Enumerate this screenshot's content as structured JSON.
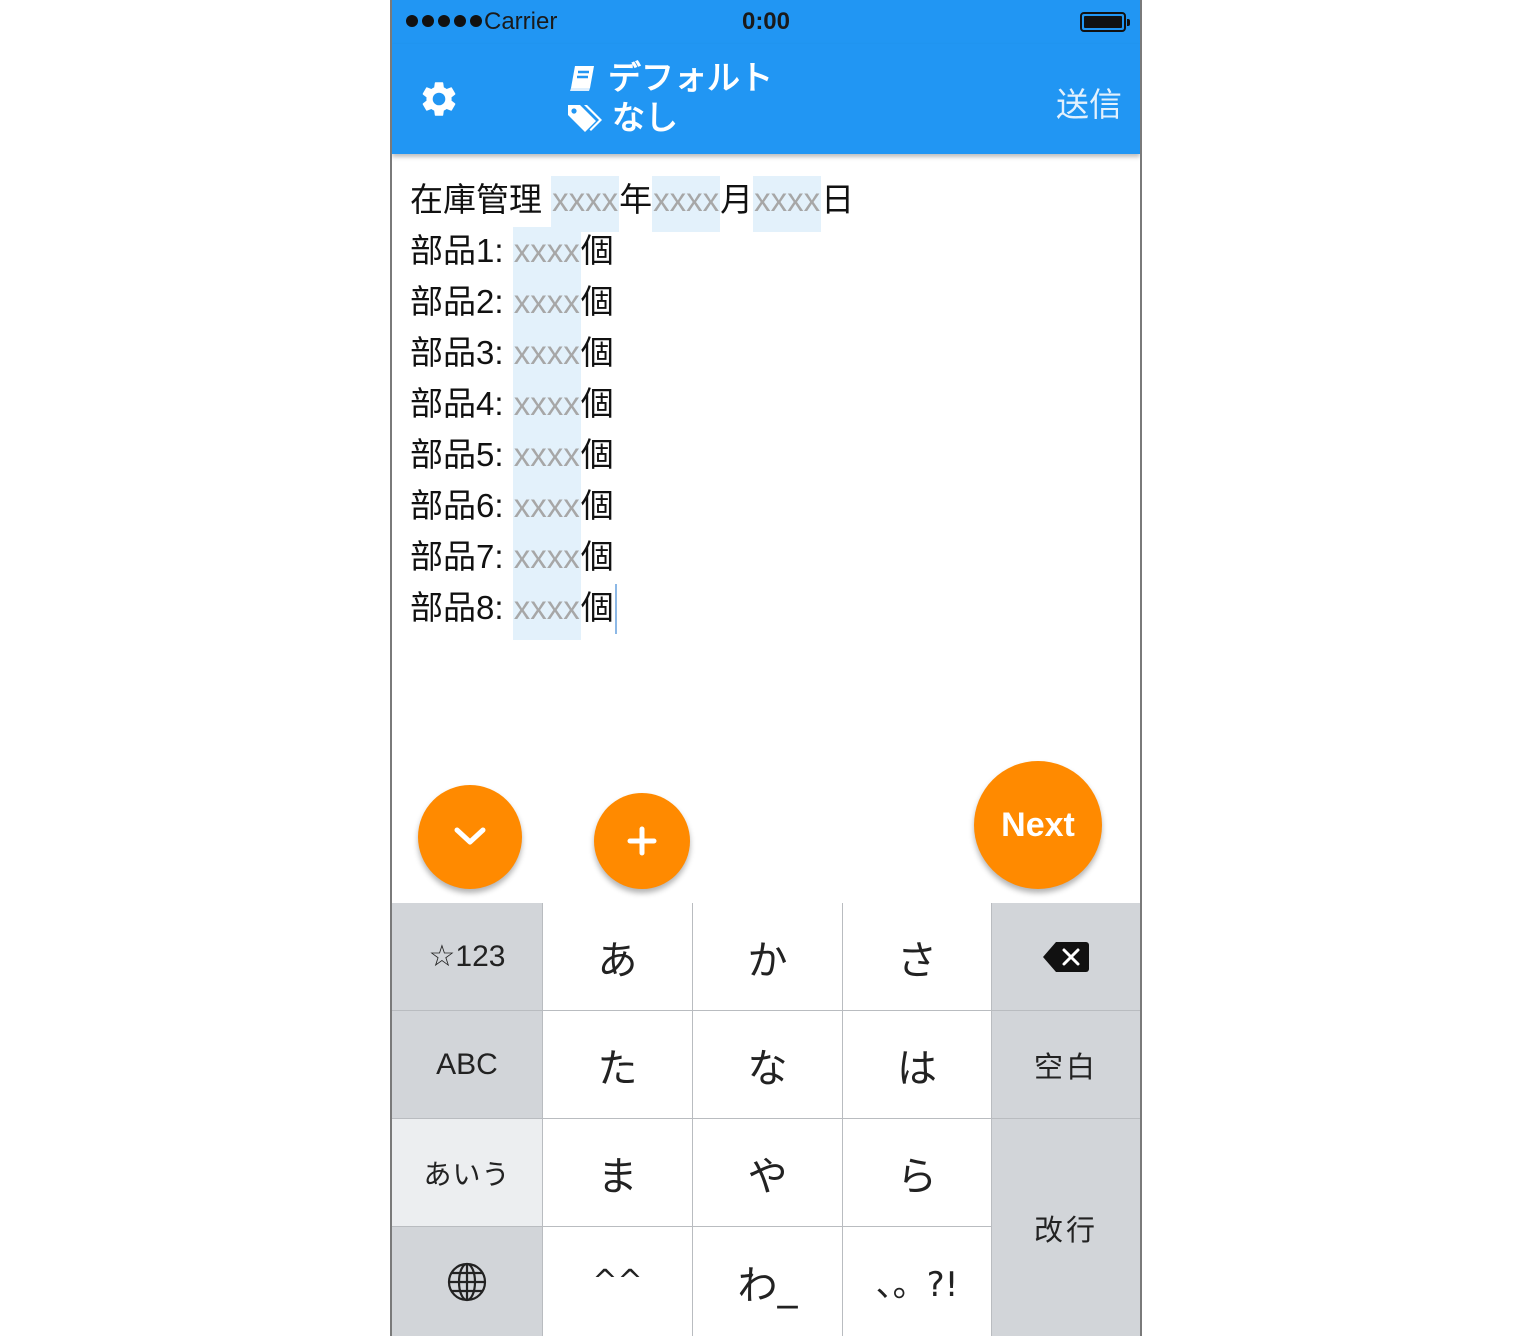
{
  "status_bar": {
    "carrier": "Carrier",
    "time": "0:00"
  },
  "nav": {
    "notebook": "デフォルト",
    "tag": "なし",
    "send_label": "送信"
  },
  "editor": {
    "title_prefix": "在庫管理 ",
    "placeholder": "xxxx",
    "year_label": "年",
    "month_label": "月",
    "day_label": "日",
    "unit": "個",
    "parts": [
      {
        "label": "部品1: "
      },
      {
        "label": "部品2: "
      },
      {
        "label": "部品3: "
      },
      {
        "label": "部品4: "
      },
      {
        "label": "部品5: "
      },
      {
        "label": "部品6: "
      },
      {
        "label": "部品7: "
      },
      {
        "label": "部品8: "
      }
    ]
  },
  "actions": {
    "next_label": "Next"
  },
  "keyboard": {
    "symbols": "☆123",
    "abc": "ABC",
    "hiragana_mode": "あいう",
    "space": "空白",
    "return": "改行",
    "kana": [
      "あ",
      "か",
      "さ",
      "た",
      "な",
      "は",
      "ま",
      "や",
      "ら",
      "^^",
      "わ_",
      "、。?!"
    ]
  },
  "colors": {
    "primary": "#2196f3",
    "accent": "#ff8a00",
    "placeholder_bg": "#e3f1fb"
  }
}
